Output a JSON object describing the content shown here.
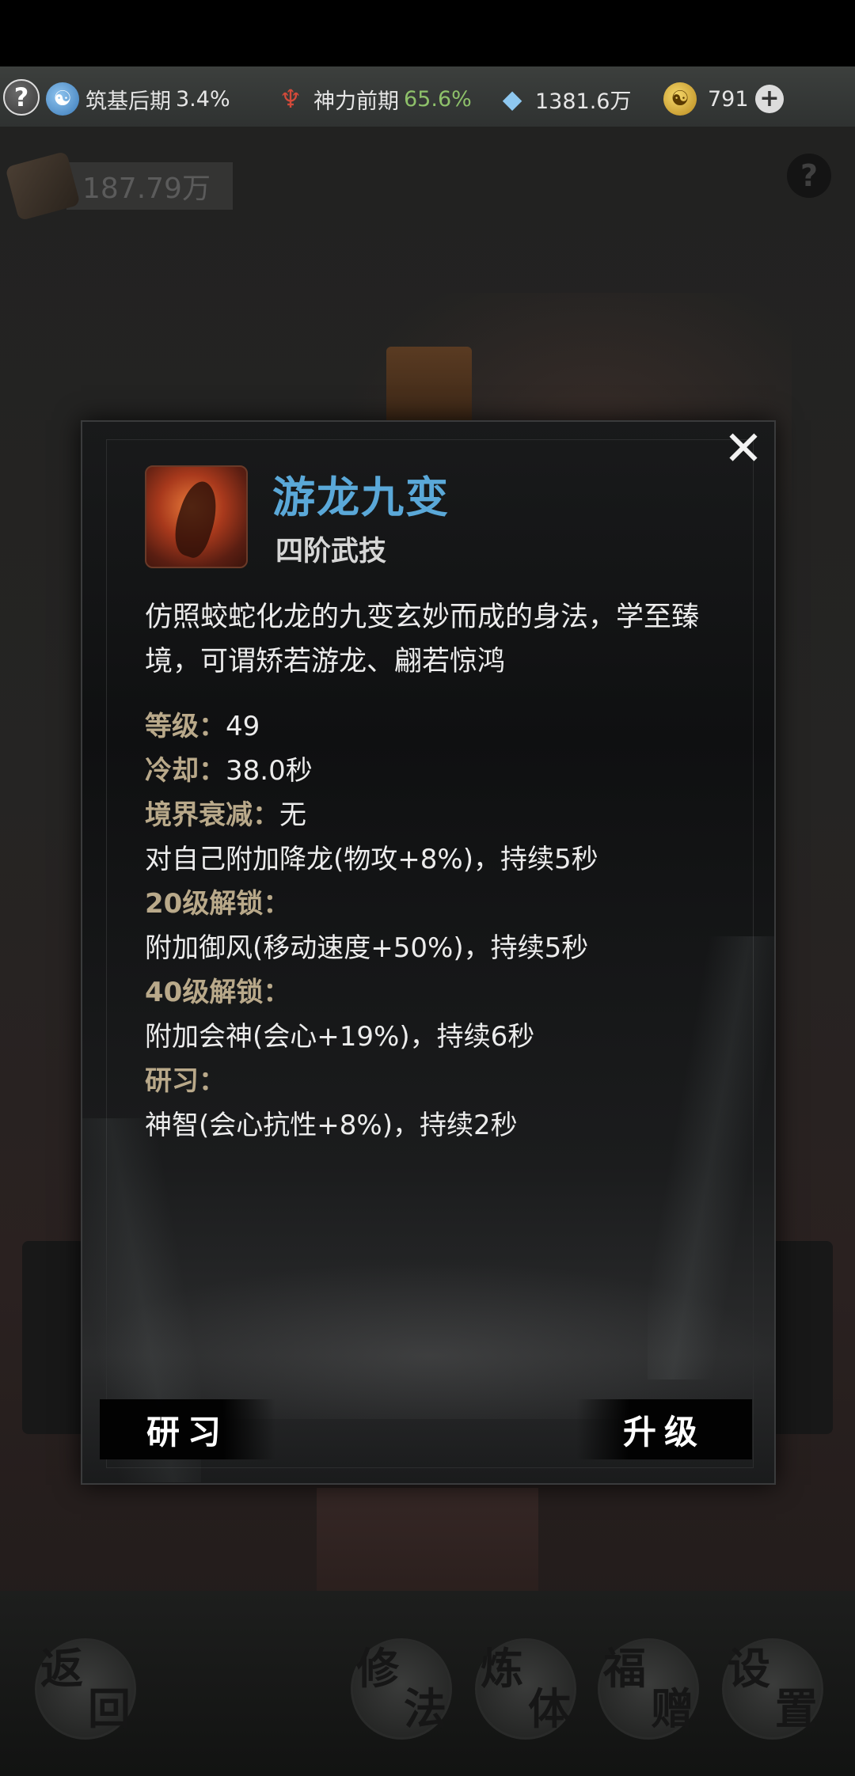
{
  "topbar": {
    "help": "?",
    "realm": {
      "name": "筑基后期",
      "percent": "3.4%"
    },
    "power": {
      "name": "神力前期",
      "percent": "65.6%"
    },
    "spirit_stones": "1381.6万",
    "gold": "791",
    "plus": "+"
  },
  "background": {
    "scroll_value": "187.79万",
    "help": "?"
  },
  "modal": {
    "close": "✕",
    "skill_name": "游龙九变",
    "skill_tier": "四阶武技",
    "description": "仿照蛟蛇化龙的九变玄妙而成的身法，学至臻境，可谓矫若游龙、翩若惊鸿",
    "level_label": "等级：",
    "level_value": "49",
    "cooldown_label": "冷却：",
    "cooldown_value": "38.0秒",
    "decay_label": "境界衰减：",
    "decay_value": "无",
    "base_effect": "对自己附加降龙(物攻+8%)，持续5秒",
    "unlock20_label": "20级解锁：",
    "unlock20_effect": "附加御风(移动速度+50%)，持续5秒",
    "unlock40_label": "40级解锁：",
    "unlock40_effect": "附加会神(会心+19%)，持续6秒",
    "study_label": "研习：",
    "study_effect": "神智(会心抗性+8%)，持续2秒",
    "study_button": "研习",
    "upgrade_button": "升级"
  },
  "bottom_nav": [
    {
      "c1": "返",
      "c2": "回"
    },
    {
      "c1": "修",
      "c2": "法"
    },
    {
      "c1": "炼",
      "c2": "体"
    },
    {
      "c1": "福",
      "c2": "赠"
    },
    {
      "c1": "设",
      "c2": "置"
    }
  ]
}
